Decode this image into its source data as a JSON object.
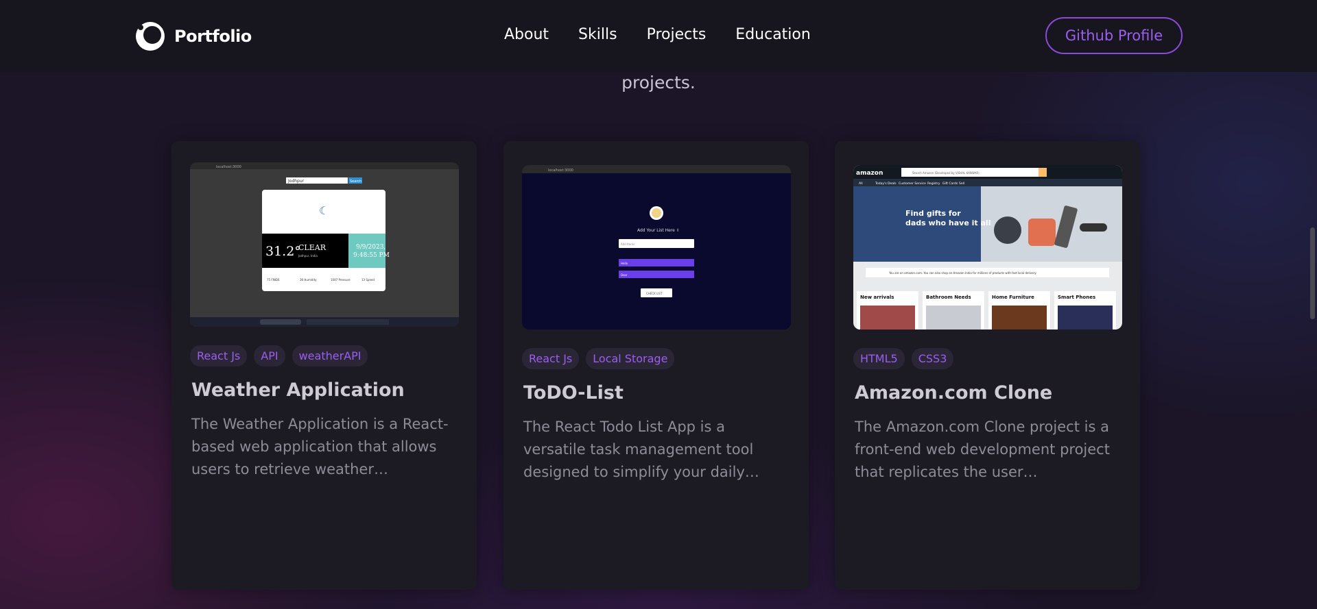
{
  "nav": {
    "logo_text": "Portfolio",
    "links": [
      "About",
      "Skills",
      "Projects",
      "Education"
    ],
    "github_label": "Github Profile"
  },
  "section": {
    "subtitle_tail": "projects."
  },
  "colors": {
    "accent": "#9c5ef0",
    "card_bg": "#1c1b24",
    "nav_bg": "#17161f"
  },
  "projects": [
    {
      "tags": [
        "React Js",
        "API",
        "weatherAPI"
      ],
      "title": "Weather Application",
      "desc": "The Weather Application is a React-based web application that allows users to retrieve weather…",
      "shot": {
        "search_placeholder": "Jodhpur",
        "search_btn": "Search",
        "temp": "31.2°",
        "condition": "CLEAR",
        "city": "Jodhpur, India",
        "date": "9/9/2023,",
        "time": "9:48:55 PM",
        "stats": [
          "75 FINDS",
          "36 Humidity",
          "1007 Pressure",
          "13 Speed"
        ],
        "address": "localhost:3000"
      }
    },
    {
      "tags": [
        "React Js",
        "Local Storage"
      ],
      "title": "ToDO-List",
      "desc": "The React Todo List App is a versatile task management tool designed to simplify your daily…",
      "shot": {
        "heading": "Add Your List Here ✌",
        "input_placeholder": "Add Items",
        "items": [
          "Hello",
          "Dear"
        ],
        "clear_label": "CHECK LIST",
        "address": "localhost:3000"
      }
    },
    {
      "tags": [
        "HTML5",
        "CSS3"
      ],
      "title": "Amazon.com Clone",
      "desc": "The Amazon.com Clone project is a front-end web development project that replicates the user…",
      "shot": {
        "logo": "amazon",
        "search_placeholder": "Search Amazon (Developed by VISHAL KANWAR)",
        "hero_text": "Find gifts for dads who have it all",
        "banner": "You are on amazon.com. You can also shop on Amazon India for millions of products with fast local delivery.",
        "nav_items": [
          "All",
          "Today's Deals",
          "Customer Service",
          "Registry",
          "Gift Cards",
          "Sell"
        ],
        "tiles": [
          "New arrivals",
          "Bathroom Needs",
          "Home Furniture",
          "Smart Phones"
        ]
      }
    }
  ]
}
